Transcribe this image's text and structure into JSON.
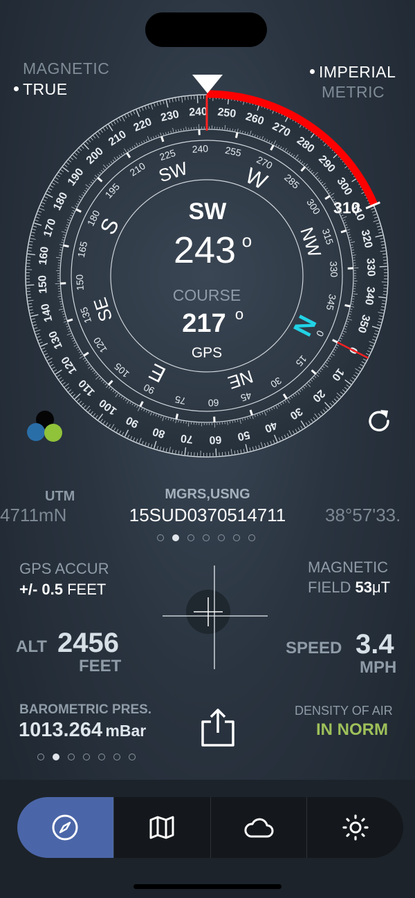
{
  "heading_mode": {
    "magnetic": "MAGNETIC",
    "true": "TRUE"
  },
  "units": {
    "imperial": "IMPERIAL",
    "metric": "METRIC"
  },
  "compass": {
    "direction": "SW",
    "heading": "243",
    "degree_symbol": "o",
    "course_label": "COURSE",
    "course": "217",
    "course_source": "GPS",
    "marker_value": "310",
    "heading_deg": 243,
    "marker_deg": 310,
    "outer_labels": [
      "0",
      "10",
      "20",
      "30",
      "40",
      "50",
      "60",
      "70",
      "80",
      "90",
      "100",
      "110",
      "120",
      "130",
      "140",
      "150",
      "160",
      "170",
      "180",
      "190",
      "200",
      "210",
      "220",
      "230",
      "240",
      "250",
      "260",
      "270",
      "280",
      "290",
      "300",
      "310",
      "320",
      "330",
      "340",
      "350"
    ],
    "inner_labels": [
      "0",
      "15",
      "30",
      "45",
      "60",
      "75",
      "90",
      "105",
      "120",
      "135",
      "150",
      "165",
      "180",
      "195",
      "210",
      "225",
      "240",
      "255",
      "270",
      "285",
      "300",
      "315",
      "330",
      "345"
    ],
    "cardinals": [
      "N",
      "NE",
      "E",
      "SE",
      "S",
      "SW",
      "W",
      "NW"
    ],
    "colors": {
      "arc": "#ff0000",
      "north": "#22d3e6",
      "heading_line": "#ff2222"
    }
  },
  "coordinates": {
    "left": {
      "label": "UTM",
      "value": "4711mN"
    },
    "center": {
      "label": "MGRS,USNG",
      "value": "15SUD0370514711"
    },
    "right": {
      "label": "",
      "value": "38°57'33."
    },
    "pages": 7,
    "active_page": 1
  },
  "gps_accuracy": {
    "label": "GPS  ACCUR",
    "value": "+/- 0.5",
    "unit": "FEET"
  },
  "magnetic_field": {
    "label": "MAGNETIC",
    "label2": "FIELD",
    "value": "53",
    "unit": "μT"
  },
  "altitude": {
    "label": "ALT",
    "value": "2456",
    "unit": "FEET"
  },
  "speed": {
    "label": "SPEED",
    "value": "3.4",
    "unit": "MPH"
  },
  "barometric": {
    "label": "BAROMETRIC PRES.",
    "value": "1013.264",
    "unit": "mBar"
  },
  "air_density": {
    "label": "DENSITY OF AIR",
    "value": "IN NORM",
    "color": "#9ec05a"
  },
  "bottom_pager": {
    "pages": 7,
    "active_page": 1
  },
  "tabs": [
    {
      "icon": "compass-icon"
    },
    {
      "icon": "map-icon"
    },
    {
      "icon": "cloud-icon"
    },
    {
      "icon": "sun-icon"
    }
  ]
}
